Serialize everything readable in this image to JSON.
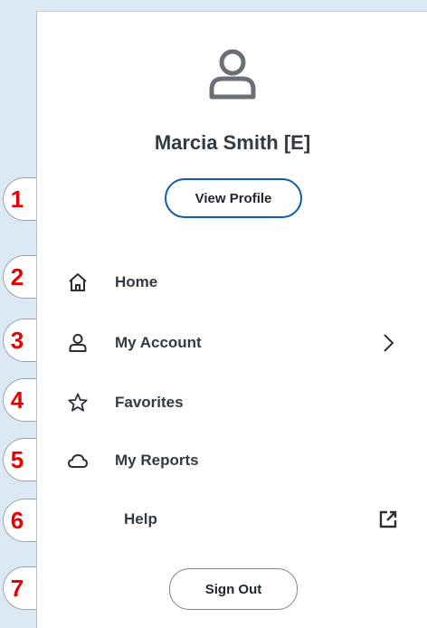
{
  "profile": {
    "name": "Marcia Smith [E]",
    "view_profile_label": "View Profile"
  },
  "menu": {
    "items": [
      {
        "label": "Home",
        "icon": "home-icon"
      },
      {
        "label": "My Account",
        "icon": "user-icon",
        "trailing_icon": "chevron-right-icon"
      },
      {
        "label": "Favorites",
        "icon": "star-icon"
      },
      {
        "label": "My Reports",
        "icon": "cloud-icon"
      },
      {
        "label": "Help",
        "trailing_icon": "external-link-icon"
      }
    ]
  },
  "sign_out_label": "Sign Out",
  "callouts": [
    "1",
    "2",
    "3",
    "4",
    "5",
    "6",
    "7"
  ],
  "colors": {
    "accent_blue": "#0b5cab",
    "callout_red": "#e60000",
    "text_dark": "#333a42",
    "page_bg": "#dde8f5"
  }
}
